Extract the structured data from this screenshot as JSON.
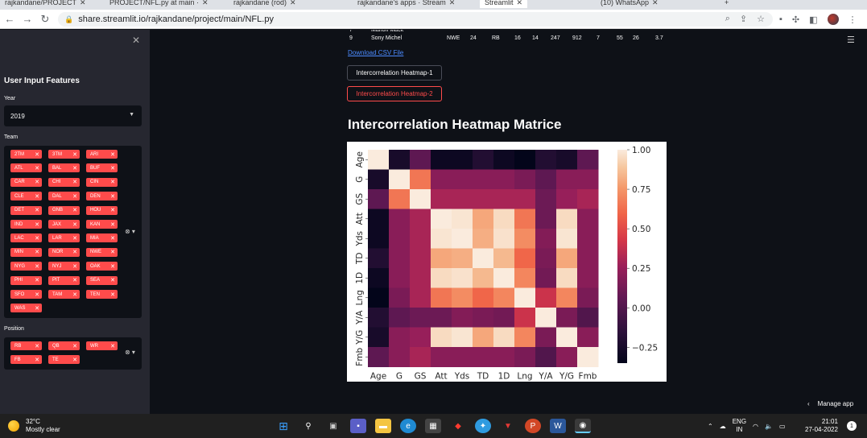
{
  "browser": {
    "tabs": [
      {
        "label": "rajkandane/PROJECT",
        "active": false
      },
      {
        "label": "PROJECT/NFL.py at main ·",
        "active": false
      },
      {
        "label": "rajkandane (rod)",
        "active": false
      },
      {
        "label": "rajkandane's apps · Stream",
        "active": false
      },
      {
        "label": "Streamlit",
        "active": true
      },
      {
        "label": "(10) WhatsApp",
        "active": false
      }
    ],
    "url": "share.streamlit.io/rajkandane/project/main/NFL.py"
  },
  "sidebar": {
    "title": "User Input Features",
    "year_label": "Year",
    "year_value": "2019",
    "team_label": "Team",
    "teams": [
      "2TM",
      "3TM",
      "ARI",
      "ATL",
      "BAL",
      "BUF",
      "CAR",
      "CHI",
      "CIN",
      "CLE",
      "DAL",
      "DEN",
      "DET",
      "GNB",
      "HOU",
      "IND",
      "JAX",
      "KAN",
      "LAC",
      "LAR",
      "MIA",
      "MIN",
      "NOR",
      "NWE",
      "NYG",
      "NYJ",
      "OAK",
      "PHI",
      "PIT",
      "SEA",
      "SFO",
      "TAM",
      "TEN",
      "WAS"
    ],
    "position_label": "Position",
    "positions": [
      "RB",
      "QB",
      "WR",
      "FB",
      "TE"
    ]
  },
  "table_partial": {
    "rows": [
      [
        "9",
        "Sony Michel",
        "NWE",
        "24",
        "RB",
        "16",
        "14",
        "247",
        "912",
        "7",
        "55",
        "26",
        "3.7"
      ]
    ]
  },
  "main": {
    "download_link": "Download CSV File",
    "button1": "Intercorrelation Heatmap-1",
    "button2": "Intercorrelation Heatmap-2",
    "heading": "Intercorrelation Heatmap Matrice",
    "manage_app": "Manage app"
  },
  "chart_data": {
    "type": "heatmap",
    "labels": [
      "Age",
      "G",
      "GS",
      "Att",
      "Yds",
      "TD",
      "1D",
      "Lng",
      "Y/A",
      "Y/G",
      "Fmb"
    ],
    "colorbar_ticks": [
      "1.00",
      "0.75",
      "0.50",
      "0.25",
      "0.00",
      "−0.25"
    ],
    "vmin": -0.35,
    "vmax": 1.0,
    "values": [
      [
        1.0,
        -0.25,
        0.05,
        -0.3,
        -0.3,
        -0.2,
        -0.3,
        -0.35,
        -0.2,
        -0.25,
        0.05
      ],
      [
        -0.25,
        1.0,
        0.65,
        0.2,
        0.2,
        0.2,
        0.2,
        0.15,
        0.05,
        0.2,
        0.2
      ],
      [
        0.05,
        0.65,
        1.0,
        0.3,
        0.3,
        0.3,
        0.3,
        0.3,
        0.1,
        0.25,
        0.3
      ],
      [
        -0.3,
        0.2,
        0.3,
        1.0,
        0.98,
        0.8,
        0.95,
        0.65,
        0.1,
        0.95,
        0.2
      ],
      [
        -0.3,
        0.2,
        0.3,
        0.98,
        1.0,
        0.82,
        0.97,
        0.72,
        0.18,
        0.98,
        0.2
      ],
      [
        -0.2,
        0.2,
        0.3,
        0.8,
        0.82,
        1.0,
        0.85,
        0.6,
        0.15,
        0.8,
        0.2
      ],
      [
        -0.3,
        0.2,
        0.3,
        0.95,
        0.97,
        0.85,
        1.0,
        0.7,
        0.12,
        0.95,
        0.2
      ],
      [
        -0.35,
        0.15,
        0.3,
        0.65,
        0.72,
        0.6,
        0.7,
        1.0,
        0.4,
        0.7,
        0.15
      ],
      [
        -0.2,
        0.05,
        0.1,
        0.1,
        0.18,
        0.15,
        0.12,
        0.4,
        1.0,
        0.15,
        0.0
      ],
      [
        -0.25,
        0.2,
        0.25,
        0.95,
        0.98,
        0.8,
        0.95,
        0.7,
        0.15,
        1.0,
        0.2
      ],
      [
        0.05,
        0.2,
        0.3,
        0.2,
        0.2,
        0.2,
        0.2,
        0.15,
        0.0,
        0.2,
        1.0
      ]
    ]
  },
  "taskbar": {
    "temperature": "32°C",
    "weather": "Mostly clear",
    "lang1": "ENG",
    "lang2": "IN",
    "time": "21:01",
    "date": "27-04-2022",
    "notifications": "1"
  },
  "colors": {
    "accent": "#ff4b4b",
    "bg": "#0e1117",
    "sidebar": "#262730"
  }
}
